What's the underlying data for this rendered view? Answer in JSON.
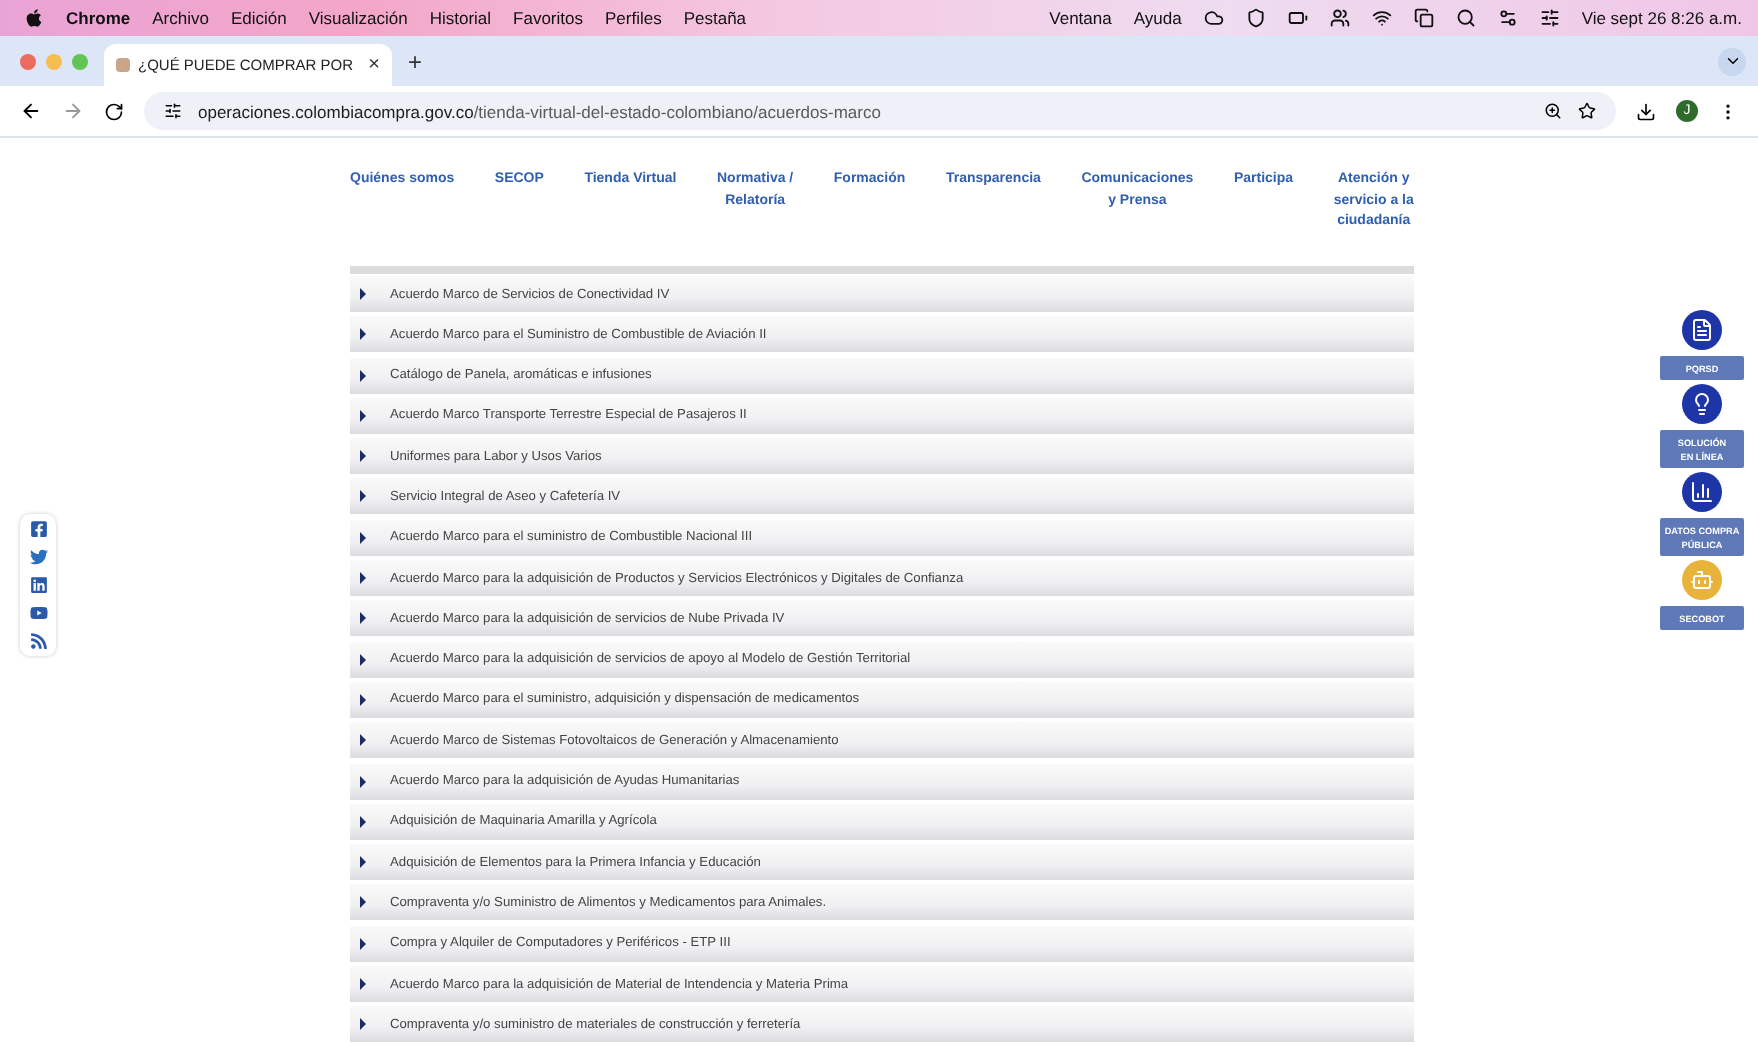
{
  "menubar": {
    "app": "Chrome",
    "menus": [
      "Archivo",
      "Edición",
      "Visualización",
      "Historial",
      "Favoritos",
      "Perfiles",
      "Pestaña"
    ],
    "right_menus": [
      "Ventana",
      "Ayuda"
    ],
    "clock": "Vie sept 26  8:26 a.m."
  },
  "tab": {
    "title": "¿QUÉ PUEDE COMPRAR POR",
    "close": "×",
    "new_tab": "+"
  },
  "address": {
    "host": "operaciones.colombiacompra.gov.co",
    "path": "/tienda-virtual-del-estado-colombiano/acuerdos-marco",
    "profile": "J"
  },
  "nav": [
    "Quiénes somos",
    "SECOP",
    "Tienda Virtual",
    "Normativa /\nRelatoría",
    "Formación",
    "Transparencia",
    "Comunicaciones\ny Prensa",
    "Participa",
    "Atención y\nservicio a la\nciudadanía"
  ],
  "items": [
    {
      "label": "Acuerdo Marco de Servicios de Conectividad IV"
    },
    {
      "label": "Acuerdo Marco para el Suministro de Combustible de Aviación II"
    },
    {
      "label": "Catálogo de Panela, aromáticas e infusiones"
    },
    {
      "label": "Acuerdo Marco Transporte Terrestre Especial de Pasajeros II"
    },
    {
      "label": "Uniformes para Labor y Usos Varios"
    },
    {
      "label": "Servicio Integral de Aseo y Cafetería IV"
    },
    {
      "label": "Acuerdo Marco para el suministro de Combustible Nacional III"
    },
    {
      "label": "Acuerdo Marco para la adquisición de Productos y Servicios Electrónicos y Digitales de Confianza"
    },
    {
      "label": "Acuerdo Marco para la adquisición de servicios de Nube Privada IV"
    },
    {
      "label": "Acuerdo Marco para la adquisición de servicios de apoyo al Modelo de Gestión Territorial"
    },
    {
      "label": "Acuerdo Marco para el suministro, adquisición y dispensación de medicamentos"
    },
    {
      "label": "Acuerdo Marco de Sistemas Fotovoltaicos de Generación y Almacenamiento"
    },
    {
      "label": "Acuerdo Marco para la adquisición de Ayudas Humanitarias"
    },
    {
      "label": "Adquisición de Maquinaria Amarilla y Agrícola"
    },
    {
      "label": "Adquisición de Elementos para la Primera Infancia y Educación"
    },
    {
      "label": "Compraventa y/o Suministro de Alimentos y Medicamentos para Animales."
    },
    {
      "label": "Compra y Alquiler de Computadores y Periféricos - ETP III"
    },
    {
      "label": "Acuerdo Marco para la adquisición de Material de Intendencia y Materia Prima"
    },
    {
      "label": "Compraventa y/o suministro de materiales de construcción y ferretería"
    }
  ],
  "widgets": [
    {
      "kind": "document",
      "label": "PQRSD"
    },
    {
      "kind": "bulb",
      "label": "SOLUCIÓN\nEN LÍNEA"
    },
    {
      "kind": "chart",
      "label": "DATOS COMPRA\nPÚBLICA"
    },
    {
      "kind": "bot",
      "label": "SECOBOT"
    }
  ],
  "social": [
    {
      "kind": "facebook"
    },
    {
      "kind": "twitter"
    },
    {
      "kind": "linkedin"
    },
    {
      "kind": "youtube"
    },
    {
      "kind": "rss"
    }
  ]
}
